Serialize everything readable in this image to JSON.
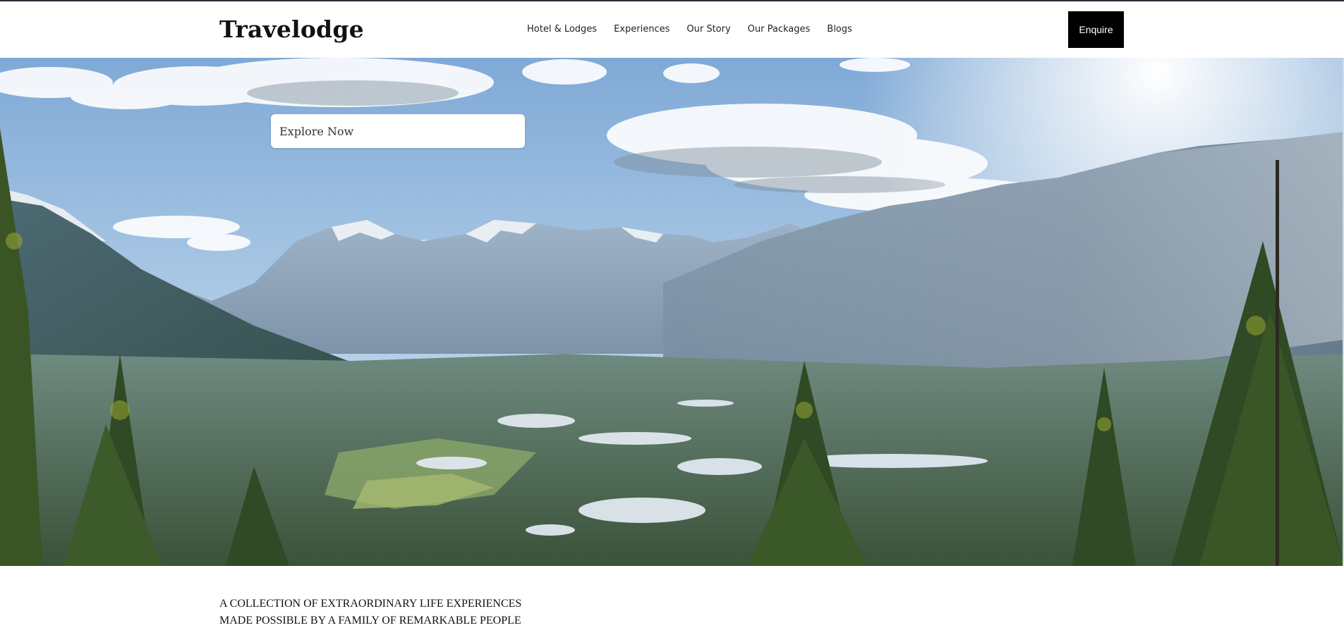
{
  "brand": {
    "logo_text": "Travelodge"
  },
  "nav": {
    "items": [
      {
        "label": "Hotel & Lodges"
      },
      {
        "label": "Experiences"
      },
      {
        "label": "Our Story"
      },
      {
        "label": "Our Packages"
      },
      {
        "label": "Blogs"
      }
    ]
  },
  "header": {
    "enquire_label": "Enquire"
  },
  "hero": {
    "image": "mountain-valley-landscape",
    "explore_label": "Explore Now"
  },
  "intro": {
    "line1": "A COLLECTION OF EXTRAORDINARY LIFE EXPERIENCES",
    "line2": "MADE POSSIBLE BY A FAMILY OF REMARKABLE PEOPLE"
  }
}
